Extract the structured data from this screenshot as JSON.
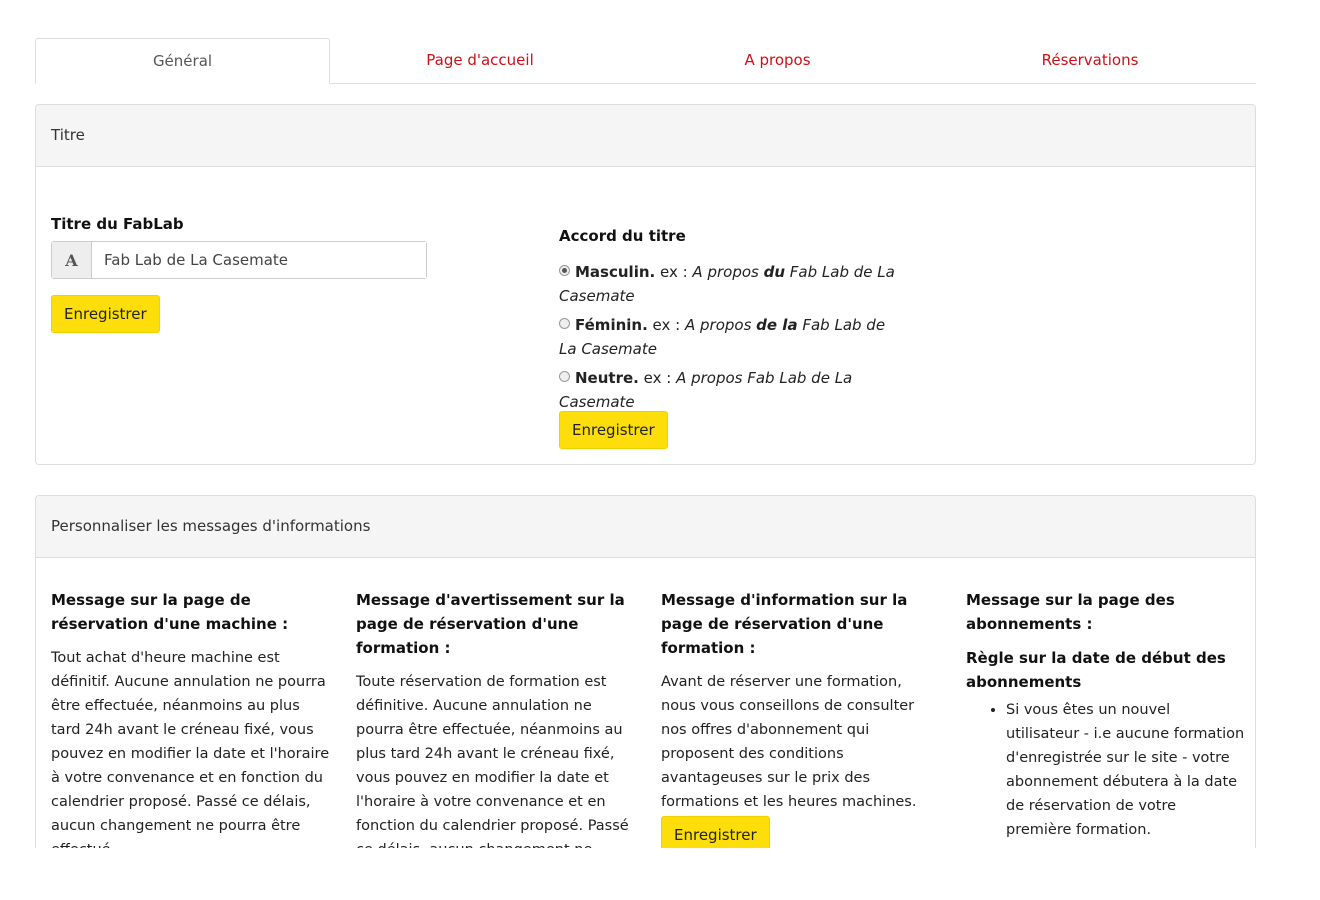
{
  "tabs": [
    {
      "label": "Général",
      "active": true
    },
    {
      "label": "Page d'accueil",
      "active": false
    },
    {
      "label": "A propos",
      "active": false
    },
    {
      "label": "Réservations",
      "active": false
    }
  ],
  "title_panel": {
    "heading": "Titre",
    "fablab_title_label": "Titre du FabLab",
    "fablab_title_value": "Fab Lab de La Casemate",
    "save_label": "Enregistrer",
    "agreement_label": "Accord du titre",
    "options": [
      {
        "name": "Masculin.",
        "ex": " ex : ",
        "pre": "A propos ",
        "art": "du",
        "post": " Fab Lab de La Casemate",
        "checked": true
      },
      {
        "name": "Féminin.",
        "ex": " ex : ",
        "pre": "A propos ",
        "art": "de la",
        "post": " Fab Lab de La Casemate",
        "checked": false
      },
      {
        "name": "Neutre.",
        "ex": " ex : ",
        "pre": "A propos Fab Lab de La Casemate",
        "art": "",
        "post": "",
        "checked": false
      }
    ],
    "agreement_save_label": "Enregistrer"
  },
  "messages_panel": {
    "heading": "Personnaliser les messages d'informations",
    "columns": [
      {
        "title": "Message sur la page de réservation d'une machine :",
        "text": "Tout achat d'heure machine est définitif. Aucune annulation ne pourra être effectuée, néanmoins au plus tard 24h avant le créneau fixé, vous pouvez en modifier la date et l'horaire à votre convenance et en fonction du calendrier proposé. Passé ce délais, aucun changement ne pourra être effectué."
      },
      {
        "title": "Message d'avertissement sur la page de réservation d'une formation :",
        "text": "Toute réservation de formation est définitive. Aucune annulation ne pourra être effectuée, néanmoins au plus tard 24h avant le créneau fixé, vous pouvez en modifier la date et l'horaire à votre convenance et en fonction du calendrier proposé. Passé ce délais, aucun changement ne pourra être effectué."
      },
      {
        "title": "Message d'information sur la page de réservation d'une formation :",
        "text": "Avant de réserver une formation, nous vous conseillons de consulter nos offres d'abonnement qui proposent des conditions avantageuses sur le prix des formations et les heures machines.",
        "save_label": "Enregistrer"
      },
      {
        "title": "Message sur la page des abonnements :",
        "subtitle": "Règle sur la date de début des abonnements",
        "bullet": "Si vous êtes un nouvel utilisateur - i.e aucune formation d'enregistrée sur le site - votre abonnement débutera à la date de réservation de votre première formation."
      }
    ]
  }
}
